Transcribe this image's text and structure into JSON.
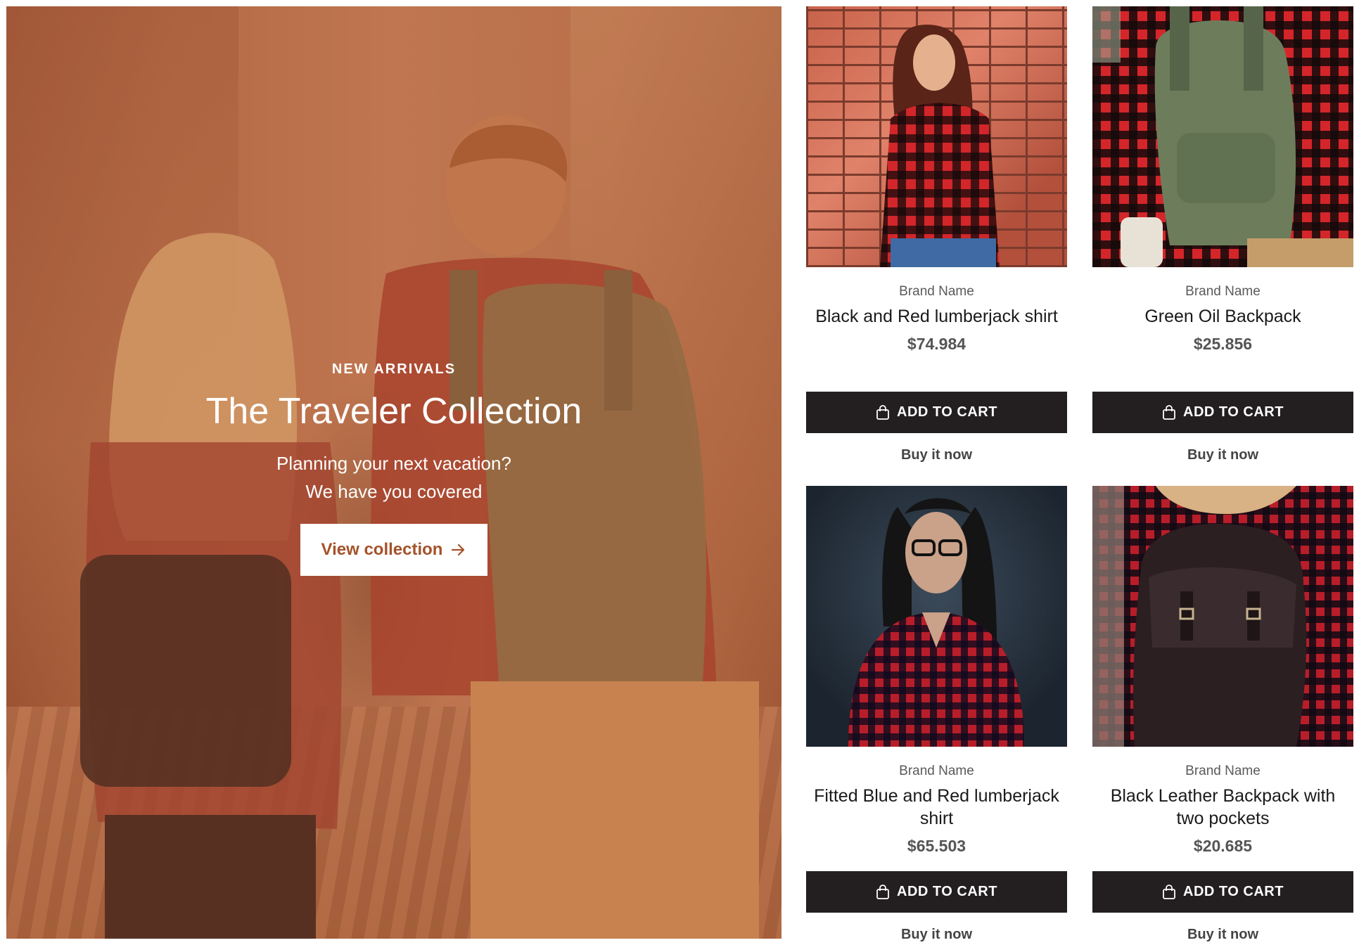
{
  "hero": {
    "eyebrow": "NEW ARRIVALS",
    "title": "The Traveler Collection",
    "text_line1": "Planning your next vacation?",
    "text_line2": "We have you covered",
    "cta_label": "View collection",
    "cta_icon": "arrow-right-icon",
    "overlay_color": "#c0784f"
  },
  "products": [
    {
      "brand": "Brand Name",
      "title": "Black and Red lumberjack shirt",
      "price": "$74.984",
      "add_to_cart": "ADD TO CART",
      "buy_now": "Buy it now"
    },
    {
      "brand": "Brand Name",
      "title": "Green Oil Backpack",
      "price": "$25.856",
      "add_to_cart": "ADD TO CART",
      "buy_now": "Buy it now"
    },
    {
      "brand": "Brand Name",
      "title": "Fitted Blue and Red lumberjack shirt",
      "price": "$65.503",
      "add_to_cart": "ADD TO CART",
      "buy_now": "Buy it now"
    },
    {
      "brand": "Brand Name",
      "title": "Black Leather Backpack with two pockets",
      "price": "$20.685",
      "add_to_cart": "ADD TO CART",
      "buy_now": "Buy it now"
    }
  ],
  "colors": {
    "button_bg": "#231f20",
    "cta_text": "#a4522a"
  },
  "icons": {
    "cart": "shopping-bag-icon"
  }
}
